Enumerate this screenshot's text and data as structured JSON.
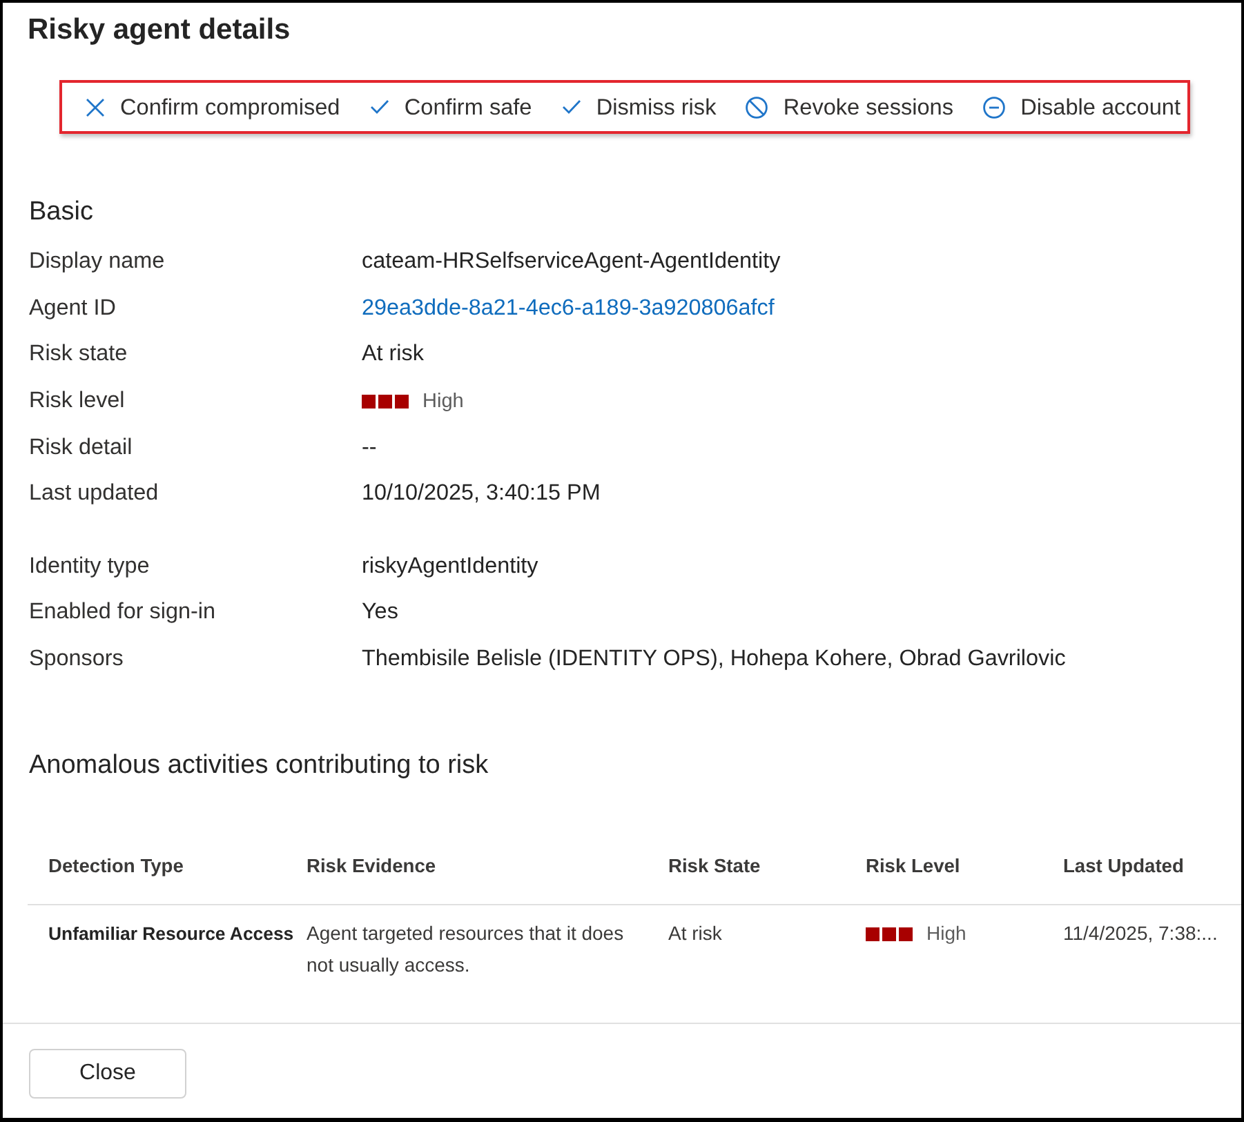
{
  "dialog": {
    "title": "Risky agent details"
  },
  "toolbar": {
    "highlighted": true,
    "actions": [
      {
        "label": "Confirm compromised",
        "kind": "compromise"
      },
      {
        "label": "Confirm safe",
        "kind": "safe"
      },
      {
        "label": "Dismiss risk",
        "kind": "dismiss"
      },
      {
        "label": "Revoke sessions",
        "kind": "revoke"
      },
      {
        "label": "Disable account",
        "kind": "disable"
      }
    ]
  },
  "basic": {
    "heading": "Basic",
    "groups": [
      [
        {
          "label": "Display name",
          "value": "cateam-HRSelfserviceAgent-AgentIdentity",
          "kind": "text"
        },
        {
          "label": "Agent ID",
          "value": "29ea3dde-8a21-4ec6-a189-3a920806afcf",
          "kind": "link"
        },
        {
          "label": "Risk state",
          "value": "At risk",
          "kind": "text"
        },
        {
          "label": "Risk level",
          "value": "High",
          "kind": "risk",
          "stars": 3
        },
        {
          "label": "Risk detail",
          "value": "--",
          "kind": "text"
        },
        {
          "label": "Last updated",
          "value": "10/10/2025, 3:40:15 PM",
          "kind": "text"
        }
      ],
      [
        {
          "label": "Identity type",
          "value": "riskyAgentIdentity",
          "kind": "text"
        },
        {
          "label": "Enabled for sign-in",
          "value": "Yes",
          "kind": "text"
        },
        {
          "label": "Sponsors",
          "value": "Thembisile Belisle (IDENTITY OPS), Hohepa Kohere, Obrad Gavrilovic",
          "kind": "text"
        }
      ]
    ]
  },
  "anomalous_activities": {
    "heading": "Anomalous activities contributing to risk",
    "columns": [
      "Detection Type",
      "Risk Evidence",
      "Risk State",
      "Risk Level",
      "Last Updated"
    ],
    "rows": [
      {
        "detection_type": "Unfamiliar Resource Access",
        "risk_evidence": "Agent targeted resources that it does not usually access.",
        "risk_state": "At risk",
        "risk_level": {
          "text": "High",
          "stars": 3
        },
        "last_updated": "11/4/2025, 7:38:..."
      }
    ]
  },
  "footer": {
    "buttons": [
      "Close"
    ]
  }
}
